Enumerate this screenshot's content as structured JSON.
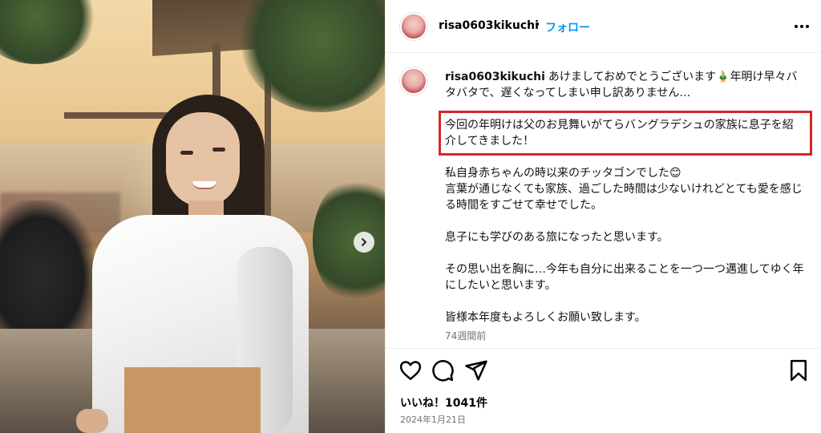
{
  "post": {
    "username": "risa0603kikuchi",
    "follow_label": "フォロー",
    "separator": "•",
    "caption_lines": {
      "line1": "あけましておめでとうございます🎍年明け早々バタバタで、遅くなってしまい申し訳ありません…",
      "highlighted": "今回の年明けは父のお見舞いがてらバングラデシュの家族に息子を紹介してきました！",
      "line3": "私自身赤ちゃんの時以来のチッタゴンでした😊",
      "line4": "言葉が通じなくても家族、過ごした時間は少ないけれどとても愛を感じる時間をすごせて幸せでした。",
      "line5": "息子にも学びのある旅になったと思います。",
      "line6": "その思い出を胸に…今年も自分に出来ることを一つ一つ邁進してゆく年にしたいと思います。",
      "line7": "皆様本年度もよろしくお願い致します。"
    },
    "time_ago": "74週間前",
    "likes": "いいね！1041件",
    "date": "2024年1月21日"
  },
  "icons": {
    "more": "more-options-icon",
    "like": "heart-icon",
    "comment": "comment-icon",
    "share": "share-icon",
    "save": "bookmark-icon",
    "next": "chevron-right-icon"
  },
  "colors": {
    "accent": "#0095f6",
    "highlight_box": "#d6262c",
    "muted": "#737373"
  }
}
